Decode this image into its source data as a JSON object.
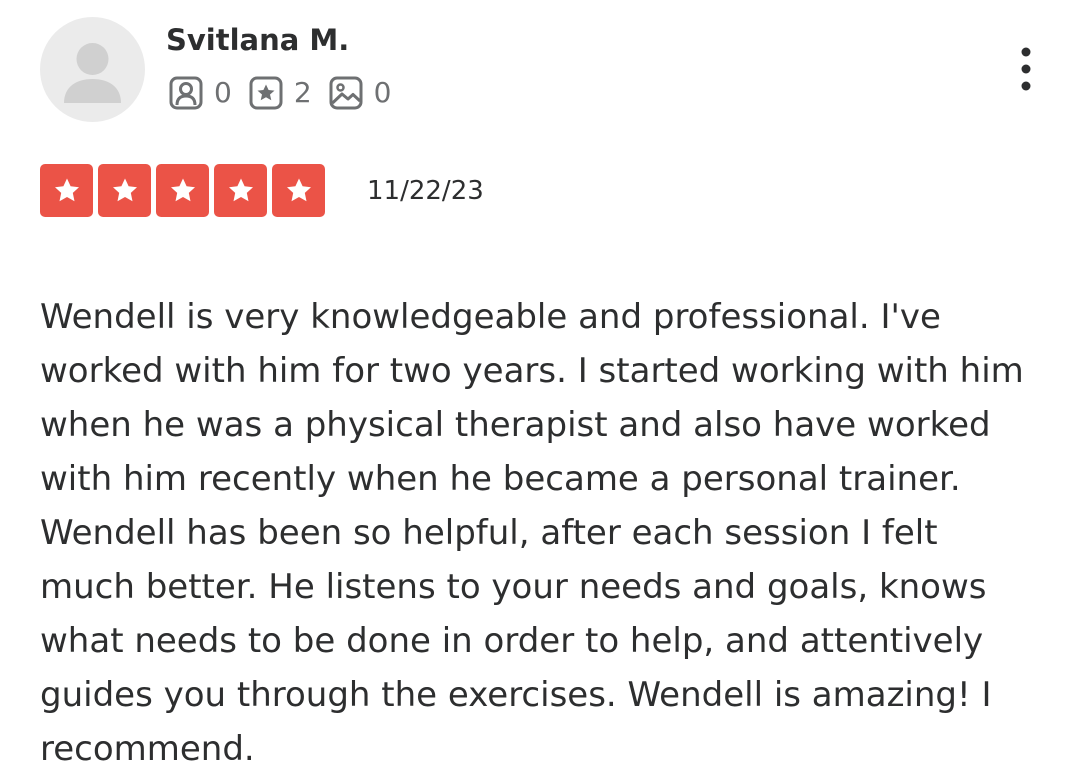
{
  "reviewer": {
    "name": "Svitlana M.",
    "stats": [
      {
        "icon": "friends-icon",
        "count": "0"
      },
      {
        "icon": "reviews-star-icon",
        "count": "2"
      },
      {
        "icon": "photos-icon",
        "count": "0"
      }
    ]
  },
  "review": {
    "rating": 5,
    "max_rating": 5,
    "date": "11/22/23",
    "text": "Wendell is very knowledgeable and professional. I've worked with him for two years. I started working with him when he was a physical therapist and also have worked with him recently when he became a personal trainer. Wendell has been so helpful, after each session I felt much better. He listens to your needs and goals, knows what needs to be done in order to help, and attentively guides you through the exercises. Wendell is amazing! I recommend."
  },
  "colors": {
    "star_fill": "#eb5347",
    "text": "#2d2e2f",
    "muted": "#6e7072",
    "avatar_bg": "#ebebeb",
    "avatar_silhouette": "#d0d0d0"
  },
  "icons": {
    "menu": "more-vertical-icon"
  }
}
